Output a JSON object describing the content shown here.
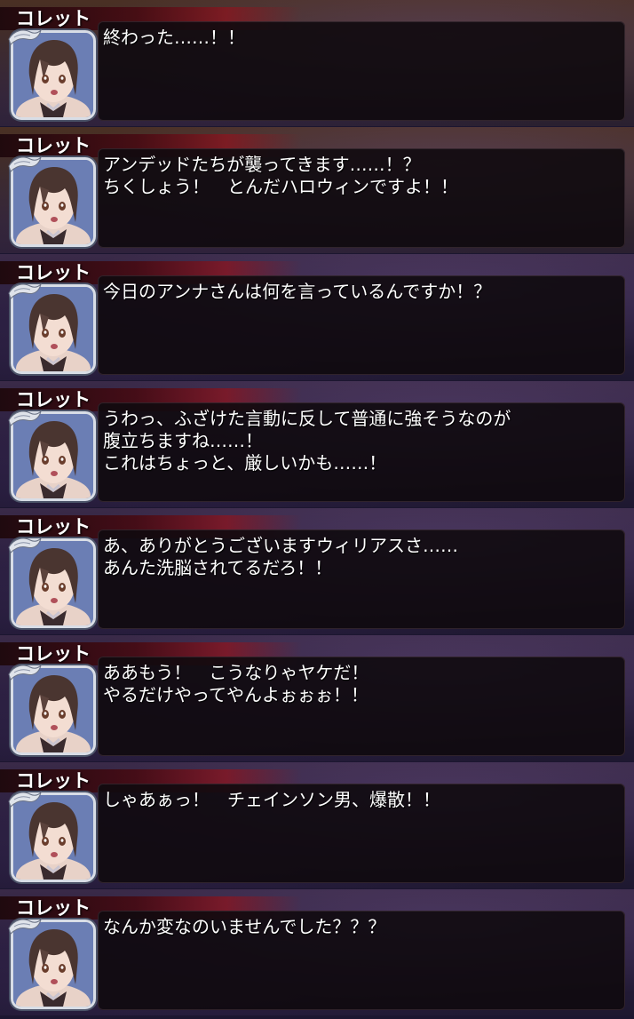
{
  "dialogs": [
    {
      "speaker": "コレット",
      "text": "終わった……！！"
    },
    {
      "speaker": "コレット",
      "text": "アンデッドたちが襲ってきます……！？\nちくしょう！　とんだハロウィンですよ！！"
    },
    {
      "speaker": "コレット",
      "text": "今日のアンナさんは何を言っているんですか！？"
    },
    {
      "speaker": "コレット",
      "text": "うわっ、ふざけた言動に反して普通に強そうなのが\n腹立ちますね……！\nこれはちょっと、厳しいかも……！"
    },
    {
      "speaker": "コレット",
      "text": "あ、ありがとうございますウィリアスさ……\nあんた洗脳されてるだろ！！"
    },
    {
      "speaker": "コレット",
      "text": "ああもう！　こうなりゃヤケだ！\nやるだけやってやんよぉぉぉ！！"
    },
    {
      "speaker": "コレット",
      "text": "しゃあぁっ！　チェインソン男、爆散！！"
    },
    {
      "speaker": "コレット",
      "text": "なんか変なのいませんでした？？？"
    }
  ],
  "colors": {
    "name_ribbon": "#8c141e",
    "box_bg": "#100a0e",
    "text": "#ffffff",
    "avatar_frame": "#d8dde6"
  },
  "icons": {
    "avatar": "colette-portrait-icon",
    "ribbon_deco": "silver-ribbon-icon"
  }
}
